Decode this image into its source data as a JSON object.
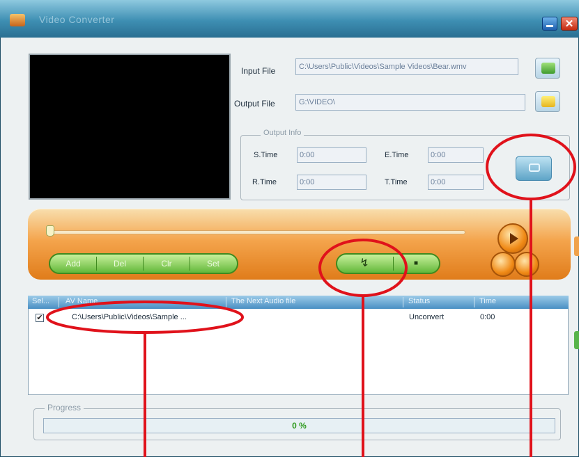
{
  "window": {
    "title": "Video Converter"
  },
  "input_file": {
    "label": "Input File",
    "value": "C:\\Users\\Public\\Videos\\Sample Videos\\Bear.wmv"
  },
  "output_file": {
    "label": "Output File",
    "value": "G:\\VIDEO\\"
  },
  "output_info": {
    "group_label": "Output Info",
    "s_time": {
      "label": "S.Time",
      "value": "0:00"
    },
    "e_time": {
      "label": "E.Time",
      "value": "0:00"
    },
    "r_time": {
      "label": "R.Time",
      "value": "0:00"
    },
    "t_time": {
      "label": "T.Time",
      "value": "0:00"
    }
  },
  "controls": {
    "playback_position": 0,
    "left_group": [
      "Add",
      "Del",
      "Clr",
      "Set"
    ],
    "convert_glyph": "↯",
    "stop_glyph": "■"
  },
  "file_list": {
    "columns": [
      "Sel...",
      "AV Name",
      "The Next Audio file",
      "Status",
      "Time"
    ],
    "rows": [
      {
        "checked": "✔",
        "name": "C:\\Users\\Public\\Videos\\Sample ...",
        "next": "",
        "status": "Unconvert",
        "time": "0:00"
      }
    ]
  },
  "progress": {
    "label": "Progress",
    "value_text": "0 %",
    "fraction": 0
  },
  "colors": {
    "annotation": "#e0121b",
    "panel": "#f4a44c",
    "green": "#63b83a"
  }
}
